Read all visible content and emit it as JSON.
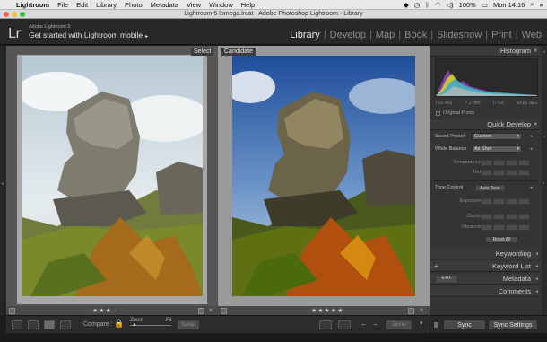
{
  "menubar": {
    "apple_icon": "apple-icon",
    "items": [
      "Lightroom",
      "File",
      "Edit",
      "Library",
      "Photo",
      "Metadata",
      "View",
      "Window",
      "Help"
    ],
    "battery": "100%",
    "clock": "Mon 14:16"
  },
  "window": {
    "title": "Lightroom 5 lomega.lrcat - Adobe Photoshop Lightroom - Library"
  },
  "identity": {
    "logo": "Lr",
    "product": "Adobe Lightroom 5",
    "tagline": "Get started with Lightroom mobile",
    "tagline_arrow": "▸"
  },
  "modules": [
    {
      "label": "Library",
      "active": true
    },
    {
      "label": "Develop",
      "active": false
    },
    {
      "label": "Map",
      "active": false
    },
    {
      "label": "Book",
      "active": false
    },
    {
      "label": "Slideshow",
      "active": false
    },
    {
      "label": "Print",
      "active": false
    },
    {
      "label": "Web",
      "active": false
    }
  ],
  "module_separator": "|",
  "compare": {
    "select_label": "Select",
    "candidate_label": "Candidate",
    "select_stars": "★★★ ·",
    "candidate_stars": "★★★★★"
  },
  "toolbar": {
    "compare_label": "Compare :",
    "zoom_label": "Zoom",
    "fit_label": "Fit",
    "swap_label": "Swap",
    "done_label": "Done"
  },
  "panels": {
    "histogram": {
      "title": "Histogram",
      "iso": "ISO 400",
      "focal": "7.1 mm",
      "aperture": "f / 5.6",
      "shutter": "1⁄500 SEC",
      "original_photo": "Original Photo"
    },
    "quick_develop": {
      "title": "Quick Develop",
      "saved_preset_label": "Saved Preset",
      "saved_preset_value": "Custom",
      "white_balance_label": "White Balance",
      "white_balance_value": "As Shot",
      "temperature_label": "Temperature",
      "tint_label": "Tint",
      "tone_control_label": "Tone Control",
      "auto_tone_label": "Auto Tone",
      "exposure_label": "Exposure",
      "clarity_label": "Clarity",
      "vibrance_label": "Vibrance",
      "reset_all_label": "Reset All"
    },
    "keywording": {
      "title": "Keywording"
    },
    "keyword_list": {
      "title": "Keyword List",
      "plus": "+"
    },
    "metadata": {
      "title": "Metadata",
      "preset": "EXIF"
    },
    "comments": {
      "title": "Comments"
    }
  },
  "sync": {
    "sync_label": "Sync",
    "sync_settings_label": "Sync Settings"
  },
  "colors": {
    "active_module": "#ececec",
    "inactive_module": "#8c8c8c",
    "panel_bg": "#343434",
    "compare_bg": "#565656"
  }
}
